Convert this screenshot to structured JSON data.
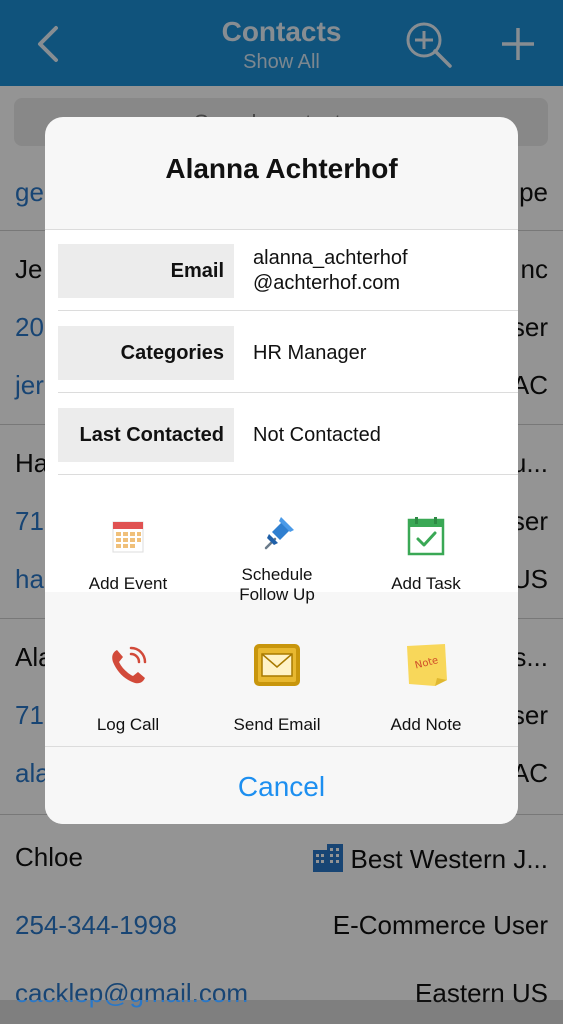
{
  "navbar": {
    "title": "Contacts",
    "subtitle": "Show All",
    "back_icon": "chevron-left-icon",
    "zoom_icon": "zoom-in-icon",
    "add_icon": "plus-icon"
  },
  "search": {
    "placeholder": "Search contacts"
  },
  "background_rows": [
    {
      "left": "ge",
      "right": "pe",
      "left_link": true
    },
    {
      "left": "Je",
      "right": "nc"
    },
    {
      "left": "20",
      "right": "ser",
      "left_link": true
    },
    {
      "left": "jer",
      "right": "AC",
      "left_link": true
    },
    {
      "left": "Ha",
      "right": "u..."
    },
    {
      "left": "71",
      "right": "ser",
      "left_link": true
    },
    {
      "left": "ha",
      "right": "US",
      "left_link": true
    },
    {
      "left": "Ala",
      "right": "s..."
    },
    {
      "left": "71",
      "right": "ser",
      "left_link": true
    },
    {
      "left": "ala",
      "right": "AC",
      "left_link": true
    },
    {
      "left": "Chloe",
      "right": "Best Western J..."
    },
    {
      "left": "254-344-1998",
      "right": "E-Commerce User",
      "left_link": true
    },
    {
      "left": "cacklep@gmail.com",
      "right": "Eastern US",
      "left_link": true
    }
  ],
  "dialog": {
    "title": "Alanna Achterhof",
    "fields": [
      {
        "label": "Email",
        "value_line1": "alanna_achterhof",
        "value_line2": "@achterhof.com"
      },
      {
        "label": "Categories",
        "value_line1": "HR Manager"
      },
      {
        "label": "Last Contacted",
        "value_line1": "Not Contacted"
      }
    ],
    "actions": [
      {
        "label": "Add Event",
        "icon": "calendar-icon"
      },
      {
        "label_line1": "Schedule",
        "label_line2": "Follow Up",
        "icon": "pushpin-icon"
      },
      {
        "label": "Add Task",
        "icon": "task-calendar-icon"
      },
      {
        "label": "Log Call",
        "icon": "phone-icon"
      },
      {
        "label": "Send Email",
        "icon": "envelope-icon"
      },
      {
        "label": "Add Note",
        "icon": "sticky-note-icon",
        "icon_text": "Note"
      }
    ],
    "cancel_label": "Cancel"
  },
  "colors": {
    "nav_blue": "#1d8fd6",
    "link_blue": "#2a78c8",
    "cancel_blue": "#1d8ff0"
  }
}
